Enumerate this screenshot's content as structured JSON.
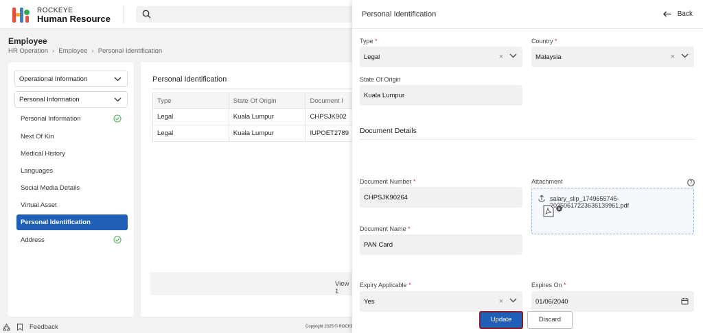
{
  "brand": {
    "line1": "ROCKEYE",
    "line2": "Human Resource",
    "colors": [
      "#e94e3c",
      "#f4a623",
      "#3b82c4",
      "#34a853"
    ]
  },
  "header": {
    "search_icon": "search-icon"
  },
  "page": {
    "title": "Employee",
    "breadcrumb": [
      "HR Operation",
      "Employee",
      "Personal Identification"
    ]
  },
  "sidebar": {
    "sections": [
      {
        "label": "Operational Information"
      },
      {
        "label": "Personal Information"
      }
    ],
    "items": [
      {
        "label": "Personal Information",
        "complete": true
      },
      {
        "label": "Next Of Kin",
        "complete": false
      },
      {
        "label": "Medical History",
        "complete": false
      },
      {
        "label": "Languages",
        "complete": false
      },
      {
        "label": "Social Media Details",
        "complete": false
      },
      {
        "label": "Virtual Asset",
        "complete": false
      },
      {
        "label": "Personal Identification",
        "active": true
      },
      {
        "label": "Address",
        "complete": true
      }
    ]
  },
  "main": {
    "title": "Personal Identification",
    "columns": [
      "Type",
      "State Of Origin",
      "Document I"
    ],
    "rows": [
      [
        "Legal",
        "Kuala Lumpur",
        "CHPSJK902"
      ],
      [
        "Legal",
        "Kuala Lumpur",
        "IUPOET2789"
      ]
    ],
    "pager_text": "View 1"
  },
  "footer": {
    "feedback": "Feedback",
    "copyright": "Copyright 2025 © ROCKE"
  },
  "drawer": {
    "title": "Personal Identification",
    "back": "Back",
    "type_label": "Type",
    "type_value": "Legal",
    "country_label": "Country",
    "country_value": "Malaysia",
    "state_label": "State Of Origin",
    "state_value": "Kuala Lumpur",
    "section": "Document Details",
    "docnum_label": "Document Number",
    "docnum_value": "CHPSJK90264",
    "attach_label": "Attachment",
    "attach_file": "salary_slip_1749655745-20250617223636139961.pdf",
    "docname_label": "Document Name",
    "docname_value": "PAN Card",
    "expiry_label": "Expiry Applicable",
    "expiry_value": "Yes",
    "expires_label": "Expires On",
    "expires_value": "01/06/2040",
    "update": "Update",
    "discard": "Discard",
    "required_mark": "*"
  }
}
